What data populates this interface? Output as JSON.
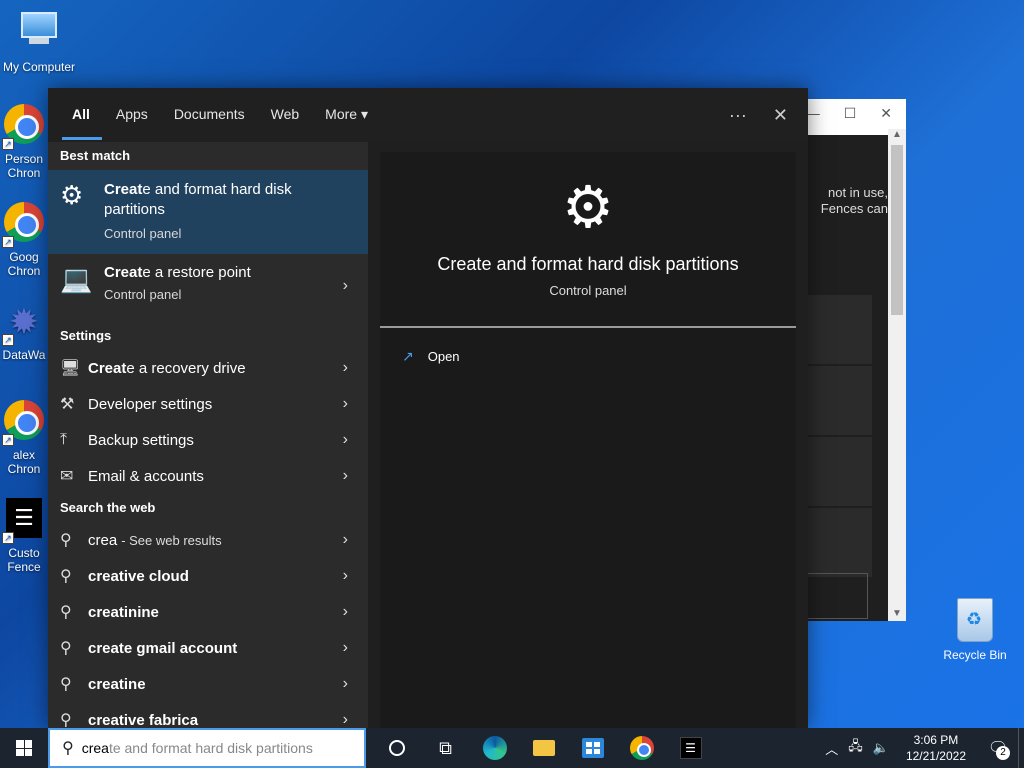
{
  "desktop": {
    "icons": [
      {
        "label": "My Computer"
      },
      {
        "label": "Person Chron"
      },
      {
        "label": "Goog Chron"
      },
      {
        "label": "DataWa"
      },
      {
        "label": "alex Chron"
      },
      {
        "label": "Custo Fence"
      }
    ],
    "recycle_bin": "Recycle Bin"
  },
  "bg_window": {
    "text_line1": "not in use,",
    "text_line2": "Fences can",
    "minimize": "—",
    "maximize": "☐",
    "close": "✕"
  },
  "search": {
    "tabs": [
      "All",
      "Apps",
      "Documents",
      "Web",
      "More"
    ],
    "more_icon": "▾",
    "options_icon": "···",
    "close_icon": "✕",
    "best_match_header": "Best match",
    "best_match": {
      "title_bold": "Creat",
      "title_rest": "e and format hard disk partitions",
      "subtitle": "Control panel"
    },
    "second_result": {
      "title_bold": "Creat",
      "title_rest": "e a restore point",
      "subtitle": "Control panel"
    },
    "settings_header": "Settings",
    "settings": [
      {
        "bold": "Creat",
        "rest": "e a recovery drive"
      },
      {
        "bold": "",
        "rest": "Developer settings"
      },
      {
        "bold": "",
        "rest": "Backup settings"
      },
      {
        "bold": "",
        "rest": "Email & accounts"
      }
    ],
    "web_header": "Search the web",
    "web": [
      {
        "q": "crea",
        "suffix": "- See web results"
      },
      {
        "q": "creative cloud",
        "suffix": ""
      },
      {
        "q": "creatinine",
        "suffix": ""
      },
      {
        "q": "create gmail account",
        "suffix": ""
      },
      {
        "q": "creatine",
        "suffix": ""
      },
      {
        "q": "creative fabrica",
        "suffix": ""
      }
    ],
    "preview": {
      "title": "Create and format hard disk partitions",
      "subtitle": "Control panel",
      "open_label": "Open"
    }
  },
  "taskbar": {
    "search_typed": "crea",
    "search_rest": "te and format hard disk partitions",
    "time": "3:06 PM",
    "date": "12/21/2022",
    "notif_count": "2",
    "tray_icons": [
      "chevron-up-icon",
      "network-icon",
      "volume-icon"
    ]
  }
}
